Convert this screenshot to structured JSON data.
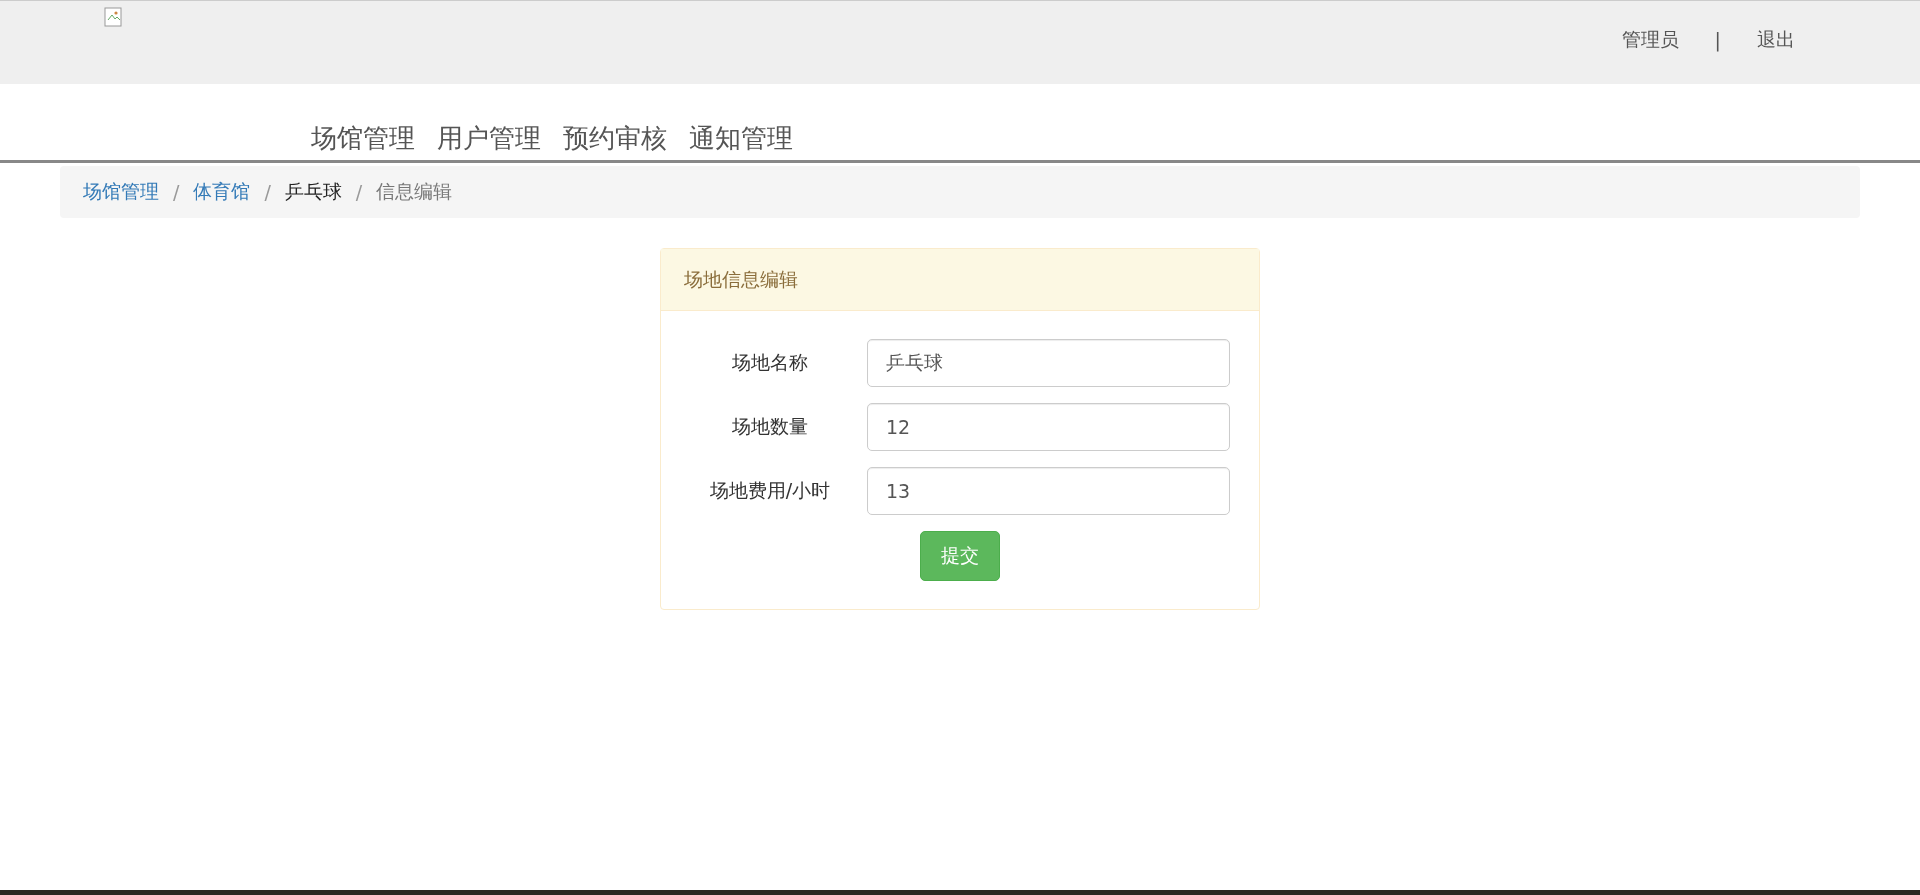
{
  "header": {
    "user": "管理员",
    "divider": "|",
    "logout": "退出"
  },
  "nav": [
    {
      "label": "场馆管理"
    },
    {
      "label": "用户管理"
    },
    {
      "label": "预约审核"
    },
    {
      "label": "通知管理"
    }
  ],
  "breadcrumb": {
    "separator": "/",
    "items": [
      {
        "label": "场馆管理",
        "kind": "link"
      },
      {
        "label": "体育馆",
        "kind": "link"
      },
      {
        "label": "乒乓球",
        "kind": "text"
      },
      {
        "label": "信息编辑",
        "kind": "active"
      }
    ]
  },
  "panel": {
    "title": "场地信息编辑",
    "fields": [
      {
        "label": "场地名称",
        "value": "乒乓球"
      },
      {
        "label": "场地数量",
        "value": "12"
      },
      {
        "label": "场地费用/小时",
        "value": "13"
      }
    ],
    "submit": "提交"
  }
}
